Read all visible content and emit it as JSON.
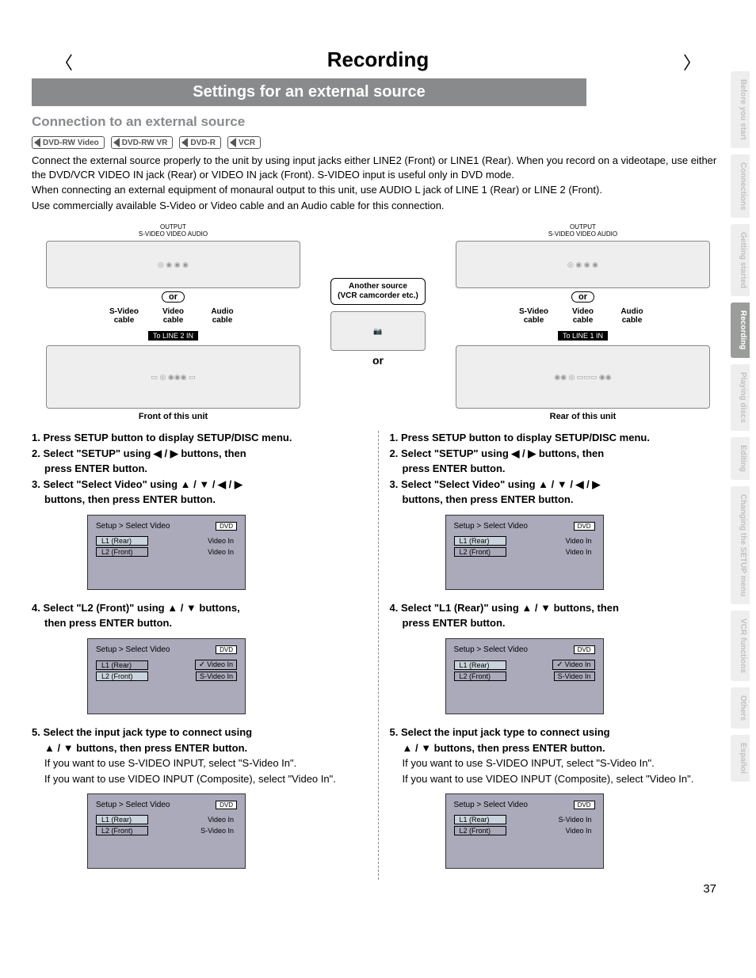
{
  "page": {
    "title": "Recording",
    "banner": "Settings for an external source",
    "subheading": "Connection to an external source",
    "pageNumber": "37"
  },
  "badges": [
    "DVD-RW Video",
    "DVD-RW VR",
    "DVD-R",
    "VCR"
  ],
  "intro": {
    "p1": "Connect the external source properly to the unit by using input jacks either LINE2 (Front) or LINE1 (Rear). When you record on a videotape, use either the DVD/VCR VIDEO IN jack (Rear) or VIDEO IN jack (Front). S-VIDEO input is useful only in DVD mode.",
    "p2": "When connecting an external equipment of monaural output to this unit, use AUDIO L jack of LINE 1 (Rear) or LINE 2 (Front).",
    "p3": "Use commercially available S-Video or Video cable and an Audio cable for this connection."
  },
  "diagram": {
    "source_box": "Another source\n(VCR camcorder etc.)",
    "output_label": "OUTPUT",
    "jacks": "S-VIDEO    VIDEO  AUDIO",
    "or_badge": "or",
    "cables": {
      "svideo": "S-Video cable",
      "video": "Video cable",
      "audio": "Audio cable"
    },
    "line2": "To LINE 2 IN",
    "line1": "To LINE 1 IN",
    "caption_left": "Front of this unit",
    "caption_right": "Rear of this unit",
    "or_center": "or"
  },
  "steps_left": {
    "s1": "1. Press SETUP button to display SETUP/DISC menu.",
    "s2a": "2. Select \"SETUP\" using ◀ / ▶ buttons, then",
    "s2b": "press ENTER button.",
    "s3a": "3. Select \"Select Video\" using ▲ / ▼ / ◀ / ▶",
    "s3b": "buttons, then press ENTER button.",
    "s4a": "4. Select \"L2 (Front)\" using ▲ / ▼ buttons,",
    "s4b": "then press ENTER button.",
    "s5a": "5. Select the input jack type to connect using",
    "s5b": "▲ / ▼ buttons, then press ENTER button.",
    "s5c": "If you want to use S-VIDEO INPUT, select \"S-Video In\".",
    "s5d": "If you want to use VIDEO INPUT (Composite), select \"Video In\"."
  },
  "steps_right": {
    "s1": "1. Press SETUP button to display SETUP/DISC menu.",
    "s2a": "2. Select \"SETUP\" using ◀ / ▶ buttons, then",
    "s2b": "press ENTER button.",
    "s3a": "3. Select \"Select Video\" using ▲ / ▼ / ◀ / ▶",
    "s3b": "buttons, then press ENTER button.",
    "s4a": "4. Select \"L1 (Rear)\" using ▲ / ▼ buttons, then",
    "s4b": "press ENTER button.",
    "s5a": "5. Select the input jack type to connect using",
    "s5b": "▲ / ▼ buttons, then press ENTER button.",
    "s5c": "If you want to use S-VIDEO INPUT, select \"S-Video In\".",
    "s5d": "If you want to use VIDEO INPUT (Composite), select \"Video In\"."
  },
  "menu": {
    "title": "Setup > Select Video",
    "dvd": "DVD",
    "l1": "L1 (Rear)",
    "l2": "L2 (Front)",
    "vin": "Video In",
    "svin": "S-Video In"
  },
  "tabs": [
    "Before you start",
    "Connections",
    "Getting started",
    "Recording",
    "Playing discs",
    "Editing",
    "Changing the SETUP menu",
    "VCR functions",
    "Others",
    "Español"
  ]
}
